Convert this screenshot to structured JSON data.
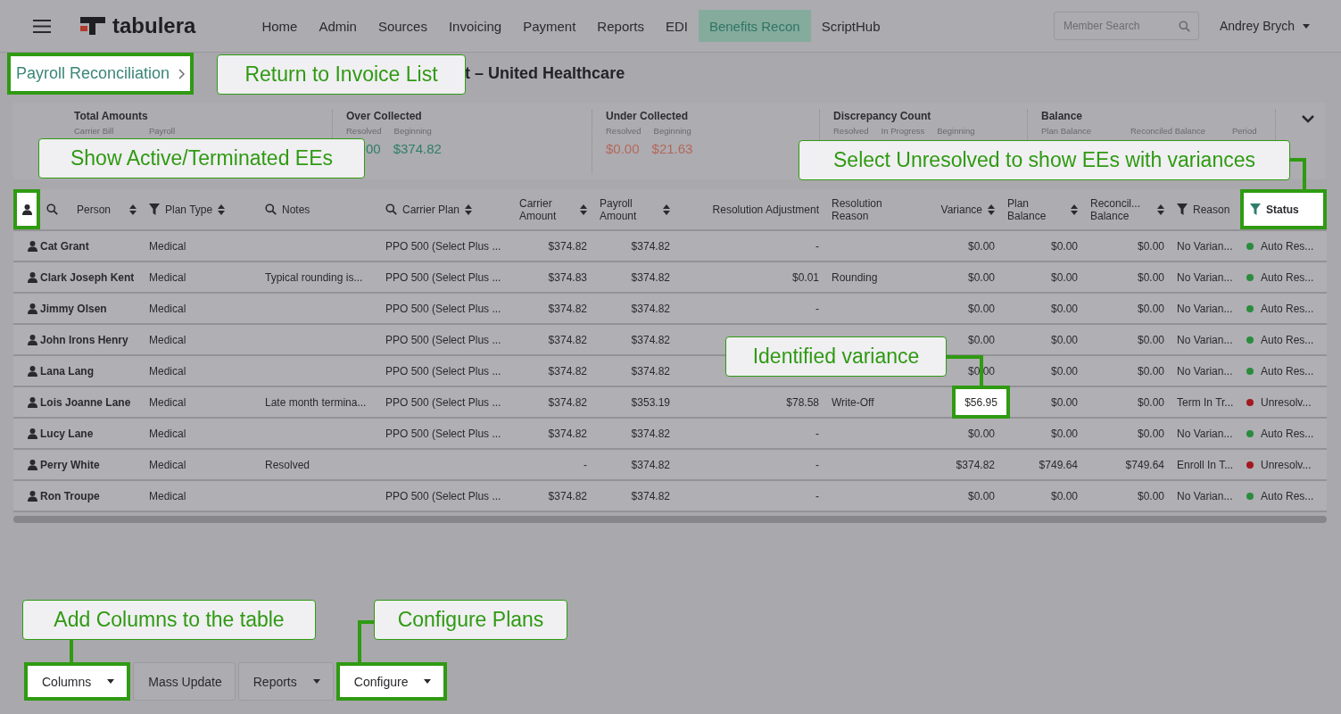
{
  "nav": {
    "brand": "tabulera",
    "items": [
      {
        "label": "Home",
        "selected": false
      },
      {
        "label": "Admin",
        "selected": false
      },
      {
        "label": "Sources",
        "selected": false
      },
      {
        "label": "Invoicing",
        "selected": false
      },
      {
        "label": "Payment",
        "selected": false
      },
      {
        "label": "Reports",
        "selected": false
      },
      {
        "label": "EDI",
        "selected": false
      },
      {
        "label": "Benefits Recon",
        "selected": true
      },
      {
        "label": "ScriptHub",
        "selected": false
      }
    ],
    "search": {
      "placeholder": "Member Search"
    },
    "user": "Andrey Brych"
  },
  "breadcrumb": {
    "label": "Payroll Reconciliation",
    "spotlight": true
  },
  "title": "t – United Healthcare",
  "summary": {
    "groups": [
      {
        "title": "Total Amounts",
        "labels": [
          "Carrier Bill",
          "Payroll"
        ]
      },
      {
        "title": "Over Collected",
        "labels": [
          "Resolved",
          "Beginning"
        ],
        "values": [
          "00",
          "$374.82"
        ]
      },
      {
        "title": "Under Collected",
        "labels": [
          "Resolved",
          "Beginning"
        ],
        "values": [
          "$0.00",
          "$21.63"
        ]
      },
      {
        "title": "Discrepancy Count",
        "labels": [
          "Resolved",
          "In Progress",
          "Beginning"
        ]
      },
      {
        "title": "Balance",
        "labels": [
          "Plan Balance",
          "Reconciled Balance",
          "Period"
        ]
      }
    ]
  },
  "table": {
    "columns": [
      {
        "kind": "person-toggle",
        "spotlight": true
      },
      {
        "kind": "text",
        "label": "Person",
        "sortable": true,
        "spotlight": false
      },
      {
        "kind": "text",
        "label": "Plan Type",
        "sortable": true,
        "spotlight": false
      },
      {
        "kind": "text",
        "label": "Notes",
        "sortable": false,
        "spotlight": false
      },
      {
        "kind": "text",
        "label": "Carrier Plan",
        "sortable": true,
        "spotlight": false
      },
      {
        "kind": "money",
        "label": "Carrier Amount",
        "sortable": true,
        "spotlight": false
      },
      {
        "kind": "money",
        "label": "Payroll Amount",
        "sortable": true,
        "spotlight": false
      },
      {
        "kind": "money",
        "label": "Resolution Adjustment",
        "sortable": false,
        "spotlight": false
      },
      {
        "kind": "text",
        "label": "Resolution Reason",
        "sortable": false,
        "spotlight": false
      },
      {
        "kind": "money",
        "label": "Variance",
        "sortable": true,
        "spotlight": false
      },
      {
        "kind": "money",
        "label": "Plan Balance",
        "sortable": true,
        "spotlight": false
      },
      {
        "kind": "money",
        "label": "Reconcil... Balance",
        "sortable": true,
        "spotlight": false
      },
      {
        "kind": "text",
        "label": "Reason",
        "sortable": false,
        "spotlight": false
      },
      {
        "kind": "text",
        "label": "Status",
        "sortable": false,
        "spotlight": true
      }
    ],
    "rows": [
      {
        "person": "Cat Grant",
        "plan_type": "Medical",
        "carrier_plan": "PPO 500 (Select Plus ...",
        "carrier_amount": "$374.82",
        "payroll_amount": "$374.82",
        "resolution_adjustment": "-",
        "variance": "$0.00",
        "variance_spotlight": false,
        "plan_balance": "$0.00",
        "reconciled_balance": "$0.00",
        "reason": "No Varian...",
        "status": "Auto Res...",
        "color": "#2a8c3c"
      },
      {
        "person": "Clark Joseph Kent",
        "plan_type": "Medical",
        "notes": "Typical rounding is...",
        "carrier_plan": "PPO 500 (Select Plus ...",
        "carrier_amount": "$374.83",
        "payroll_amount": "$374.82",
        "resolution_adjustment": "$0.01",
        "resolution_reason": "Rounding",
        "variance": "$0.00",
        "variance_spotlight": false,
        "plan_balance": "$0.00",
        "reconciled_balance": "$0.00",
        "reason": "No Varian...",
        "status": "Auto Res...",
        "color": "#2a8c3c"
      },
      {
        "person": "Jimmy Olsen",
        "plan_type": "Medical",
        "carrier_plan": "PPO 500 (Select Plus ...",
        "carrier_amount": "$374.82",
        "payroll_amount": "$374.82",
        "resolution_adjustment": "-",
        "variance": "$0.00",
        "variance_spotlight": false,
        "plan_balance": "$0.00",
        "reconciled_balance": "$0.00",
        "reason": "No Varian...",
        "status": "Auto Res...",
        "color": "#2a8c3c"
      },
      {
        "person": "John Irons Henry",
        "plan_type": "Medical",
        "carrier_plan": "PPO 500 (Select Plus ...",
        "carrier_amount": "$374.82",
        "payroll_amount": "$374.82",
        "variance": "$0.00",
        "variance_spotlight": false,
        "plan_balance": "$0.00",
        "reconciled_balance": "$0.00",
        "reason": "No Varian...",
        "status": "Auto Res...",
        "color": "#2a8c3c"
      },
      {
        "person": "Lana Lang",
        "plan_type": "Medical",
        "carrier_plan": "PPO 500 (Select Plus ...",
        "carrier_amount": "$374.82",
        "payroll_amount": "$374.82",
        "variance": "$0.00",
        "variance_spotlight": false,
        "plan_balance": "$0.00",
        "reconciled_balance": "$0.00",
        "reason": "No Varian...",
        "status": "Auto Res...",
        "color": "#2a8c3c"
      },
      {
        "person": "Lois Joanne Lane",
        "plan_type": "Medical",
        "notes": "Late month termina...",
        "carrier_plan": "PPO 500 (Select Plus ...",
        "carrier_amount": "$374.82",
        "payroll_amount": "$353.19",
        "resolution_adjustment": "$78.58",
        "resolution_reason": "Write-Off",
        "variance": "$56.95",
        "variance_spotlight": true,
        "plan_balance": "$0.00",
        "reconciled_balance": "$0.00",
        "reason": "Term In Tr...",
        "status": "Unresolv...",
        "color": "#a3191f"
      },
      {
        "person": "Lucy Lane",
        "plan_type": "Medical",
        "carrier_plan": "PPO 500 (Select Plus ...",
        "carrier_amount": "$374.82",
        "payroll_amount": "$374.82",
        "resolution_adjustment": "-",
        "variance": "$0.00",
        "variance_spotlight": false,
        "plan_balance": "$0.00",
        "reconciled_balance": "$0.00",
        "reason": "No Varian...",
        "status": "Auto Res...",
        "color": "#2a8c3c"
      },
      {
        "person": "Perry White",
        "plan_type": "Medical",
        "notes": "Resolved",
        "carrier_amount": "-",
        "payroll_amount": "$374.82",
        "resolution_adjustment": "-",
        "variance": "$374.82",
        "variance_spotlight": false,
        "plan_balance": "$749.64",
        "reconciled_balance": "$749.64",
        "reason": "Enroll In T...",
        "status": "Unresolv...",
        "color": "#a3191f"
      },
      {
        "person": "Ron Troupe",
        "plan_type": "Medical",
        "carrier_plan": "PPO 500 (Select Plus ...",
        "carrier_amount": "$374.82",
        "payroll_amount": "$374.82",
        "resolution_adjustment": "-",
        "variance": "$0.00",
        "variance_spotlight": false,
        "plan_balance": "$0.00",
        "reconciled_balance": "$0.00",
        "reason": "No Varian...",
        "status": "Auto Res...",
        "color": "#2a8c3c"
      }
    ]
  },
  "toolbar": {
    "buttons": [
      {
        "label": "Columns",
        "dropdown": true,
        "spotlight": true
      },
      {
        "label": "Mass Update",
        "dropdown": false,
        "spotlight": false
      },
      {
        "label": "Reports",
        "dropdown": true,
        "spotlight": false
      },
      {
        "label": "Configure",
        "dropdown": true,
        "spotlight": true
      }
    ]
  },
  "callouts": [
    {
      "text": "Return to Invoice List"
    },
    {
      "text": "Show Active/Terminated EEs"
    },
    {
      "text": "Select Unresolved to show EEs with variances"
    },
    {
      "text": "Identified variance"
    },
    {
      "text": "Add Columns to the table"
    },
    {
      "text": "Configure Plans"
    }
  ]
}
